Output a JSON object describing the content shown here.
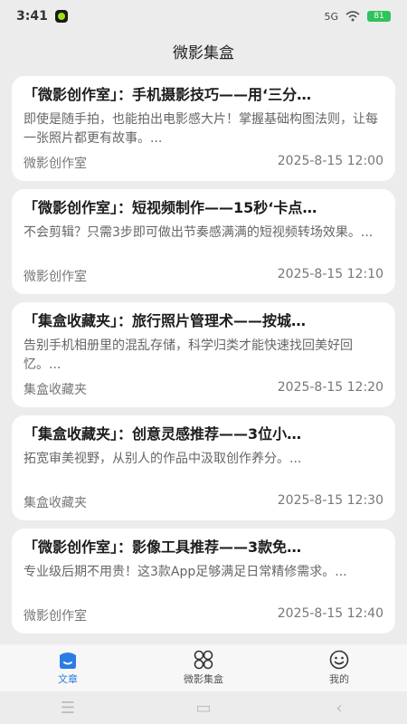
{
  "status_bar": {
    "time": "3:41",
    "signal": "5G",
    "battery": "81"
  },
  "header": {
    "title": "微影集盒"
  },
  "articles": [
    {
      "title": "「微影创作室」：手机摄影技巧——用‘三分…",
      "desc": "即使是随手拍，也能拍出电影感大片！掌握基础构图法则，让每一张照片都更有故事。...",
      "source": "微影创作室",
      "time": "2025-8-15 12:00"
    },
    {
      "title": "「微影创作室」：短视频制作——15秒‘卡点…",
      "desc": "不会剪辑？只需3步即可做出节奏感满满的短视频转场效果。...",
      "source": "微影创作室",
      "time": "2025-8-15 12:10"
    },
    {
      "title": "「集盒收藏夹」：旅行照片管理术——按城…",
      "desc": "告别手机相册里的混乱存储，科学归类才能快速找回美好回忆。...",
      "source": "集盒收藏夹",
      "time": "2025-8-15 12:20"
    },
    {
      "title": "「集盒收藏夹」：创意灵感推荐——3位小…",
      "desc": "拓宽审美视野，从别人的作品中汲取创作养分。...",
      "source": "集盒收藏夹",
      "time": "2025-8-15 12:30"
    },
    {
      "title": "「微影创作室」：影像工具推荐——3款免…",
      "desc": "专业级后期不用贵！这3款App足够满足日常精修需求。...",
      "source": "微影创作室",
      "time": "2025-8-15 12:40"
    }
  ],
  "tabs": [
    {
      "label": "文章",
      "icon": "article-icon",
      "active": true
    },
    {
      "label": "微影集盒",
      "icon": "grid-icon",
      "active": false
    },
    {
      "label": "我的",
      "icon": "smile-icon",
      "active": false
    }
  ],
  "colors": {
    "accent": "#2a7de1",
    "background": "#ececec",
    "card": "#ffffff"
  }
}
